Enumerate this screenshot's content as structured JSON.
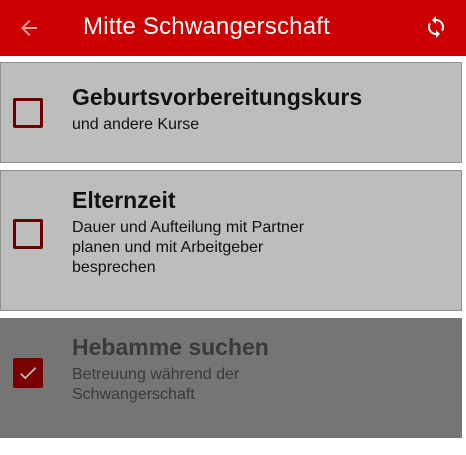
{
  "toolbar": {
    "title": "Mitte Schwangerschaft",
    "back_icon": "arrow-left-icon",
    "refresh_icon": "sync-icon",
    "background": "#cc0000"
  },
  "items": [
    {
      "title": "Geburtsvorbereitungskurs",
      "subtitle": "und andere Kurse",
      "checked": false
    },
    {
      "title": "Elternzeit",
      "subtitle": "Dauer und Aufteilung mit Partner planen und mit Arbeitgeber besprechen",
      "checked": false
    },
    {
      "title": "Hebamme suchen",
      "subtitle": "Betreuung während der Schwangerschaft",
      "checked": true
    }
  ],
  "colors": {
    "card": "#bdbdbd",
    "card_done": "#757575",
    "checkbox": "#7a0000"
  }
}
